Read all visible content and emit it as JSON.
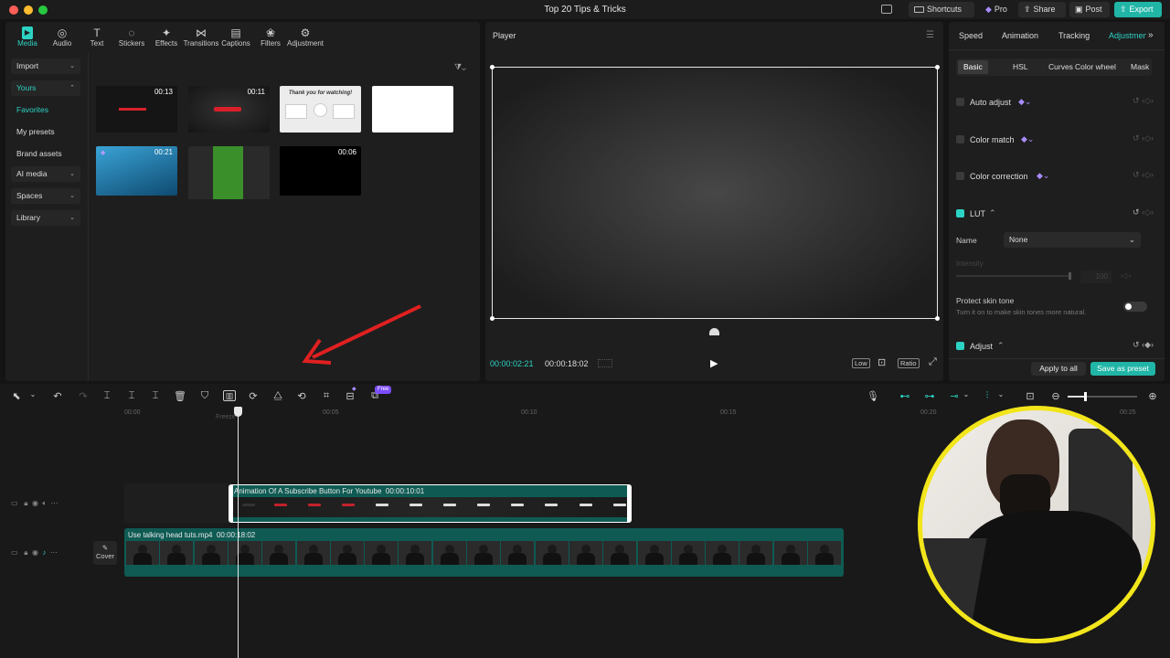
{
  "window": {
    "title": "Top 20 Tips & Tricks"
  },
  "titlebar": {
    "shortcuts": "Shortcuts",
    "pro": "Pro",
    "share": "Share",
    "post": "Post",
    "export": "Export"
  },
  "toolbar": {
    "items": [
      {
        "label": "Media",
        "icon": "media-icon"
      },
      {
        "label": "Audio",
        "icon": "audio-icon"
      },
      {
        "label": "Text",
        "icon": "text-icon"
      },
      {
        "label": "Stickers",
        "icon": "stickers-icon"
      },
      {
        "label": "Effects",
        "icon": "effects-icon"
      },
      {
        "label": "Transitions",
        "icon": "transitions-icon"
      },
      {
        "label": "Captions",
        "icon": "captions-icon"
      },
      {
        "label": "Filters",
        "icon": "filters-icon"
      },
      {
        "label": "Adjustment",
        "icon": "adjustment-icon"
      }
    ]
  },
  "sidebar": {
    "import": "Import",
    "yours": "Yours",
    "favorites": "Favorites",
    "my_presets": "My presets",
    "brand_assets": "Brand assets",
    "ai_media": "AI media",
    "spaces": "Spaces",
    "library": "Library"
  },
  "media": {
    "thumbs": [
      {
        "duration": "00:13"
      },
      {
        "duration": "00:11"
      },
      {
        "duration": "",
        "caption": "Thank you for watching!"
      },
      {
        "duration": ""
      },
      {
        "duration": "00:21"
      },
      {
        "duration": ""
      },
      {
        "duration": "00:06"
      }
    ]
  },
  "player": {
    "title": "Player",
    "current_time": "00:00:02:21",
    "total_time": "00:00:18:02",
    "low": "Low",
    "ratio": "Ratio"
  },
  "inspector": {
    "tabs": [
      "Speed",
      "Animation",
      "Tracking",
      "Adjustment"
    ],
    "subtabs": [
      "Basic",
      "HSL",
      "Curves",
      "Color wheel",
      "Mask"
    ],
    "auto_adjust": "Auto adjust",
    "color_match": "Color match",
    "color_correction": "Color correction",
    "lut": "LUT",
    "name_label": "Name",
    "name_value": "None",
    "intensity": "Intensity",
    "intensity_value": "100",
    "protect_skin": "Protect skin tone",
    "protect_desc": "Turn it on to make skin tones more natural.",
    "adjust": "Adjust",
    "apply_all": "Apply to all",
    "save_preset": "Save as preset"
  },
  "timeline": {
    "ticks": [
      "00:00",
      "00:05",
      "00:10",
      "00:15",
      "00:20",
      "00:25"
    ],
    "tooltip": "Freeze",
    "free_badge": "Free",
    "clip1": {
      "name": "Animation Of A Subscribe Button For Youtube",
      "duration": "00:00:10:01"
    },
    "clip2": {
      "name": "Use talking head tuts.mp4",
      "duration": "00:00:18:02"
    },
    "cover": "Cover"
  },
  "colors": {
    "accent": "#2cd3c4",
    "clip": "#0f5b54",
    "annotation": "#e02020",
    "ring": "#f2e51a"
  }
}
